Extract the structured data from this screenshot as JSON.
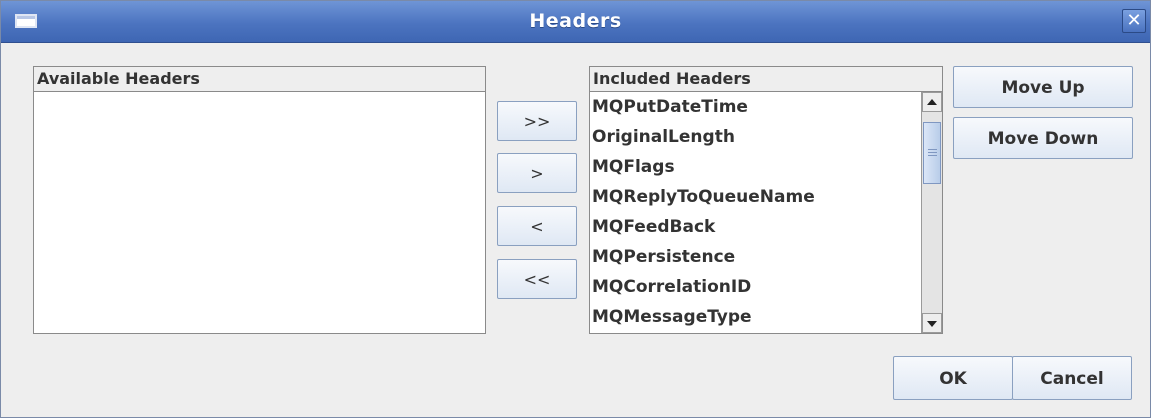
{
  "window": {
    "title": "Headers",
    "system_icon": "window-menu-icon",
    "close_icon": "close-icon",
    "close_glyph": "✕"
  },
  "available": {
    "header": "Available Headers",
    "items": []
  },
  "included": {
    "header": "Included Headers",
    "items": [
      "MQPutDateTime",
      "OriginalLength",
      "MQFlags",
      "MQReplyToQueueName",
      "MQFeedBack",
      "MQPersistence",
      "MQCorrelationID",
      "MQMessageType"
    ]
  },
  "transfer": {
    "add_all": ">>",
    "add": ">",
    "remove": "<",
    "remove_all": "<<"
  },
  "order": {
    "move_up": "Move Up",
    "move_down": "Move Down"
  },
  "footer": {
    "ok": "OK",
    "cancel": "Cancel"
  },
  "colors": {
    "titlebar": "#4c74c0",
    "dialog_bg": "#eeeeee",
    "button_border": "#8aa0c0"
  }
}
